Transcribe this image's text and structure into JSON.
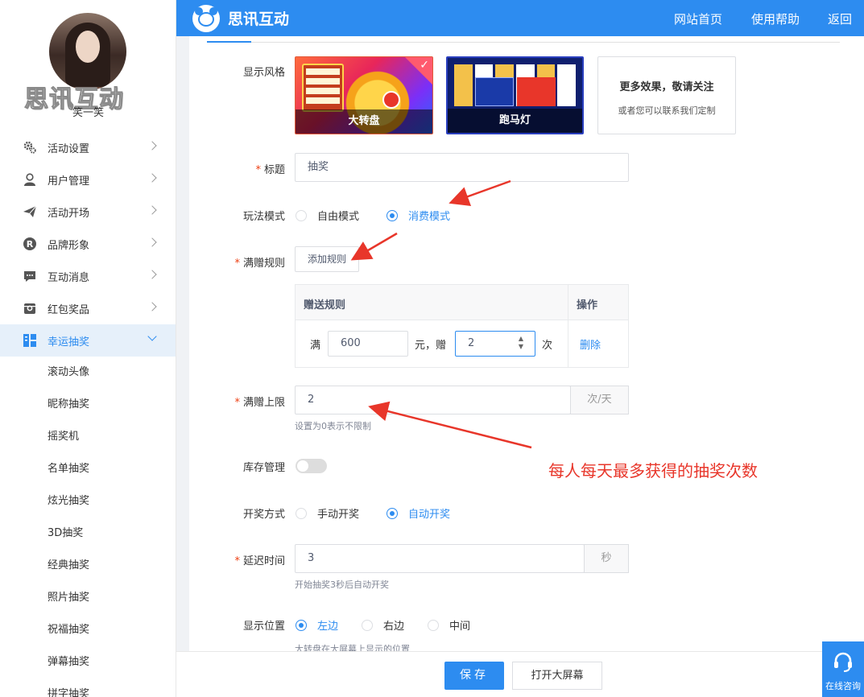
{
  "sidebar": {
    "brand_watermark": "思讯互动",
    "username": "笑一笑",
    "menu": [
      {
        "label": "活动设置",
        "icon": "gears-icon"
      },
      {
        "label": "用户管理",
        "icon": "user-icon"
      },
      {
        "label": "活动开场",
        "icon": "paper-plane-icon"
      },
      {
        "label": "品牌形象",
        "icon": "registered-icon"
      },
      {
        "label": "互动消息",
        "icon": "chat-bubble-icon"
      },
      {
        "label": "红包奖品",
        "icon": "gift-box-icon"
      },
      {
        "label": "幸运抽奖",
        "icon": "lottery-icon",
        "active": true
      }
    ],
    "submenu": [
      "滚动头像",
      "昵称抽奖",
      "摇奖机",
      "名单抽奖",
      "炫光抽奖",
      "3D抽奖",
      "经典抽奖",
      "照片抽奖",
      "祝福抽奖",
      "弹幕抽奖",
      "拼字抽奖"
    ]
  },
  "topbar": {
    "logo_text": "思讯互动",
    "nav": [
      "网站首页",
      "使用帮助",
      "返回"
    ],
    "color": "#2d8cf0"
  },
  "form": {
    "display_style": {
      "label": "显示风格",
      "cards": [
        {
          "caption": "大转盘",
          "selected": true
        },
        {
          "caption": "跑马灯",
          "selected": false
        }
      ],
      "more_title": "更多效果，敬请关注",
      "more_sub": "或者您可以联系我们定制"
    },
    "title": {
      "label": "标题",
      "value": "抽奖"
    },
    "play_mode": {
      "label": "玩法模式",
      "options": [
        "自由模式",
        "消费模式"
      ],
      "selected": 1
    },
    "gift_rule": {
      "label": "满赠规则",
      "add_button": "添加规则",
      "table_head": [
        "赠送规则",
        "操作"
      ],
      "row": {
        "prefix": "满",
        "amount": "600",
        "mid": "元，赠",
        "count": "2",
        "suffix": "次",
        "delete": "删除"
      }
    },
    "gift_limit": {
      "label": "满赠上限",
      "value": "2",
      "unit": "次/天",
      "hint": "设置为0表示不限制"
    },
    "stock": {
      "label": "库存管理",
      "enabled": false
    },
    "draw_mode": {
      "label": "开奖方式",
      "options": [
        "手动开奖",
        "自动开奖"
      ],
      "selected": 1
    },
    "delay": {
      "label": "延迟时间",
      "value": "3",
      "unit": "秒",
      "hint": "开始抽奖3秒后自动开奖"
    },
    "position": {
      "label": "显示位置",
      "options": [
        "左边",
        "右边",
        "中间"
      ],
      "selected": 0,
      "hint": "大转盘在大屏幕上显示的位置"
    }
  },
  "annotation": {
    "text": "每人每天最多获得的抽奖次数",
    "color": "#e8362a"
  },
  "footer": {
    "save": "保存",
    "open_screen": "打开大屏幕",
    "consult": "在线咨询"
  }
}
